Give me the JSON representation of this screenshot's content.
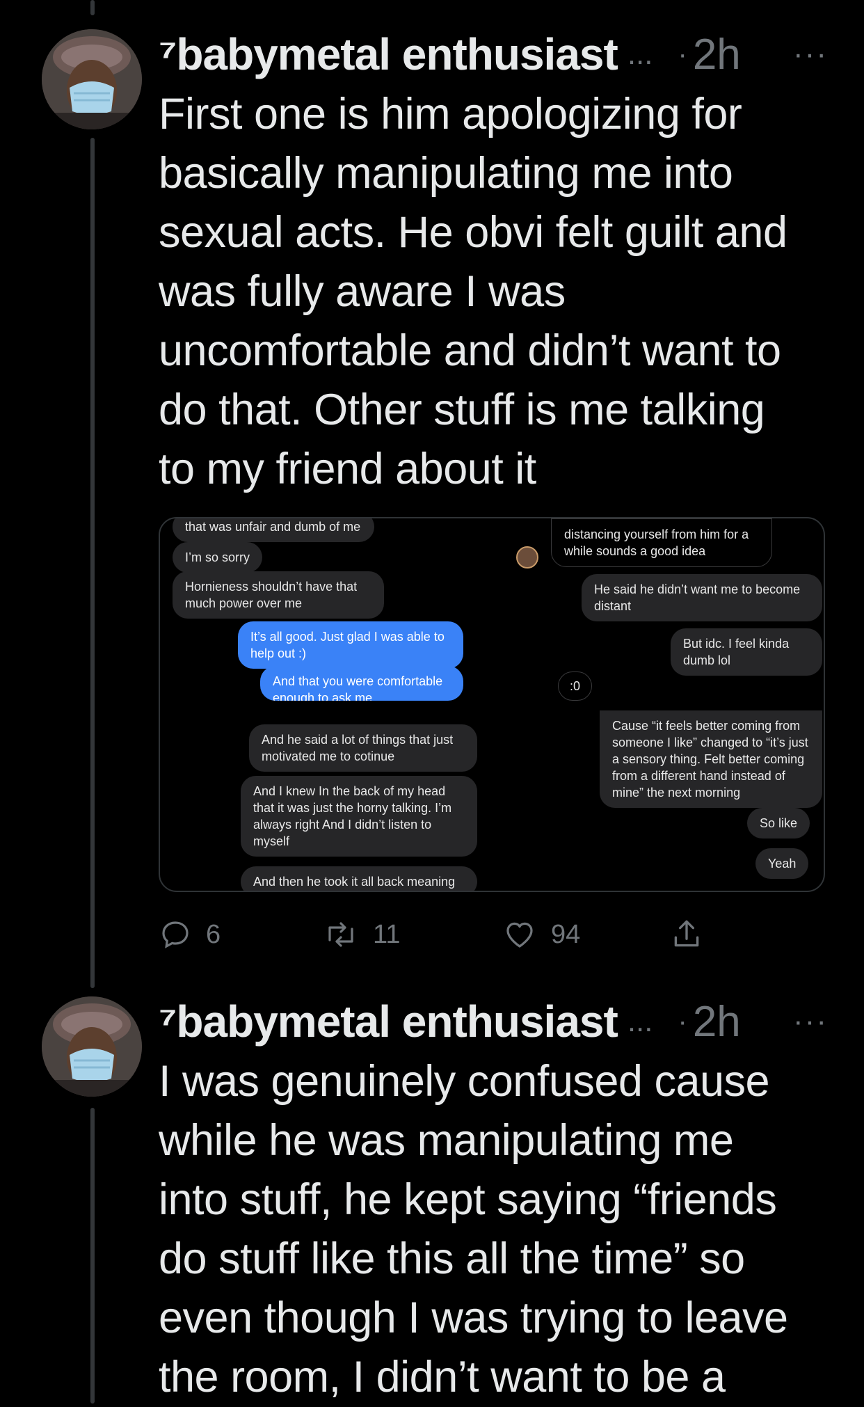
{
  "tweets": [
    {
      "display_name": "⁷babymetal enthusiast",
      "name_ellipsis": "...",
      "dot": "·",
      "time": "2h",
      "more": "···",
      "text_lines": [
        "First one is him apologizing for",
        "basically manipulating me into",
        "sexual acts. He obvi felt guilt and",
        "was fully aware I was",
        "uncomfortable and didn’t want to",
        "do that. Other stuff is me talking",
        "to my friend about it"
      ],
      "media": {
        "left_chat": [
          "that was unfair and dumb of me",
          "I’m so sorry",
          "Hornieness shouldn’t have that much power over me",
          "It’s all good. Just glad I was able to help out :)",
          "And that you were comfortable enough to ask me",
          "And he said a lot of things that just motivated me to cotinue",
          "And I knew In the back of my head that it was just the horny talking. I’m always right And I didn’t listen to myself",
          "And then he took it all back meaning"
        ],
        "right_chat": [
          "distancing yourself from him for a while sounds a good idea",
          "He said he didn’t want me to become distant",
          "But idc. I feel kinda dumb lol",
          ":0",
          "Cause “it feels better coming from someone I like” changed to “it’s just a sensory thing. Felt better coming from a different hand instead of mine” the next morning",
          "So like",
          "Yeah"
        ]
      },
      "actions": {
        "replies": "6",
        "retweets": "11",
        "likes": "94"
      }
    },
    {
      "display_name": "⁷babymetal enthusiast",
      "name_ellipsis": "...",
      "dot": "·",
      "time": "2h",
      "more": "···",
      "text_lines": [
        "I was genuinely confused cause",
        "while he was manipulating me",
        "into stuff, he kept saying “friends",
        "do stuff like this all the time” so",
        "even though I was trying to leave",
        "the room, I didn’t want to be a"
      ]
    }
  ],
  "icons": {
    "reply": "reply-icon",
    "retweet": "retweet-icon",
    "like": "heart-icon",
    "share": "share-icon",
    "more": "more-icon"
  }
}
